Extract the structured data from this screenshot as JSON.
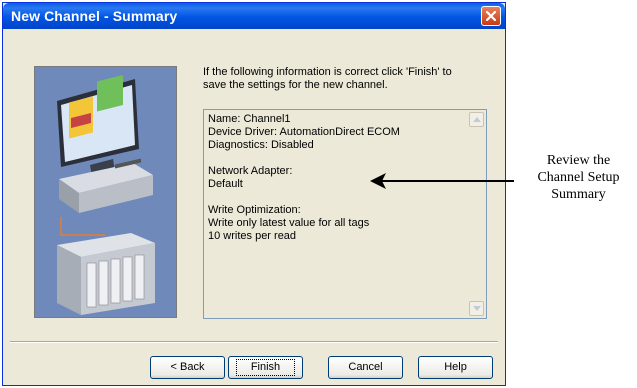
{
  "window": {
    "title": "New Channel - Summary"
  },
  "intro": {
    "line1": "If the following information is correct click 'Finish' to",
    "line2": "save the settings for the new channel."
  },
  "summary": {
    "lines": [
      "Name: Channel1",
      "Device Driver: AutomationDirect ECOM",
      "Diagnostics: Disabled",
      "",
      "Network Adapter:",
      "Default",
      "",
      "Write Optimization:",
      "Write only latest value for all tags",
      "10 writes per read"
    ]
  },
  "buttons": {
    "back": "< Back",
    "finish": "Finish",
    "cancel": "Cancel",
    "help": "Help"
  },
  "callout": {
    "line1": "Review the",
    "line2": "Channel Setup",
    "line3": "Summary"
  },
  "icons": {
    "close": "close-icon",
    "illustration": "pc-to-plc-illustration"
  },
  "colors": {
    "titlebar": "#0055e5",
    "dialog_bg": "#ece9d8",
    "close_button": "#c53b13"
  }
}
